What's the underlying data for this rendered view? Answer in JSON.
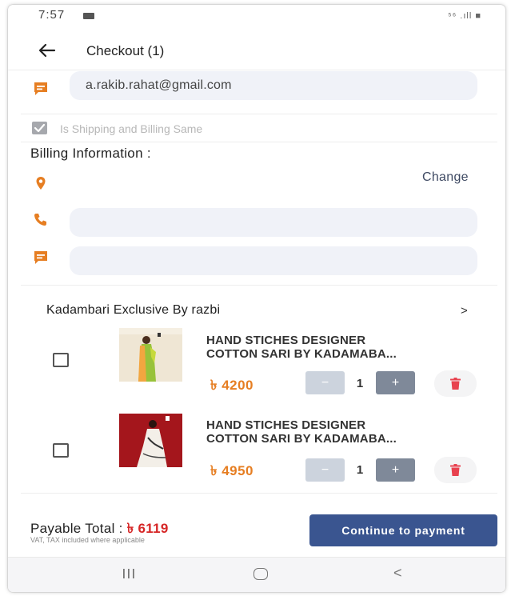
{
  "status_bar": {
    "time": "7:57",
    "signal": "⁵⁶ .ıll ■"
  },
  "header": {
    "back_icon": "arrow-left-icon",
    "title": "Checkout (1)"
  },
  "contact": {
    "email": "a.rakib.rahat@gmail.com",
    "icon": "message-icon"
  },
  "shipping_same": {
    "label": "Is Shipping and Billing Same",
    "checked": true
  },
  "billing": {
    "title": "Billing Information :",
    "change_label": "Change",
    "location_icon": "location-pin-icon",
    "phone_icon": "phone-icon",
    "phone_value": "",
    "note_icon": "message-icon",
    "note_value": ""
  },
  "shop": {
    "name": "Kadambari Exclusive By razbi",
    "chevron": ">"
  },
  "items": [
    {
      "name_line1": "HAND STICHES DESIGNER",
      "name_line2": "COTTON SARI BY KADAMABA...",
      "price": "৳ 4200",
      "qty": "1",
      "minus": "−",
      "plus": "+",
      "checked": false
    },
    {
      "name_line1": "HAND STICHES DESIGNER",
      "name_line2": "COTTON SARI BY KADAMABA...",
      "price": "৳ 4950",
      "qty": "1",
      "minus": "−",
      "plus": "+",
      "checked": false
    }
  ],
  "footer": {
    "payable_label": "Payable Total : ",
    "payable_amount": "৳ 6119",
    "vat_note": "VAT, TAX included where applicable",
    "continue_label": "Continue to payment"
  },
  "nav": {
    "back_glyph": "<"
  },
  "colors": {
    "accent_orange": "#e67e22",
    "primary_button": "#3a5590",
    "total_red": "#d62626",
    "field_bg": "#f0f2f8"
  }
}
